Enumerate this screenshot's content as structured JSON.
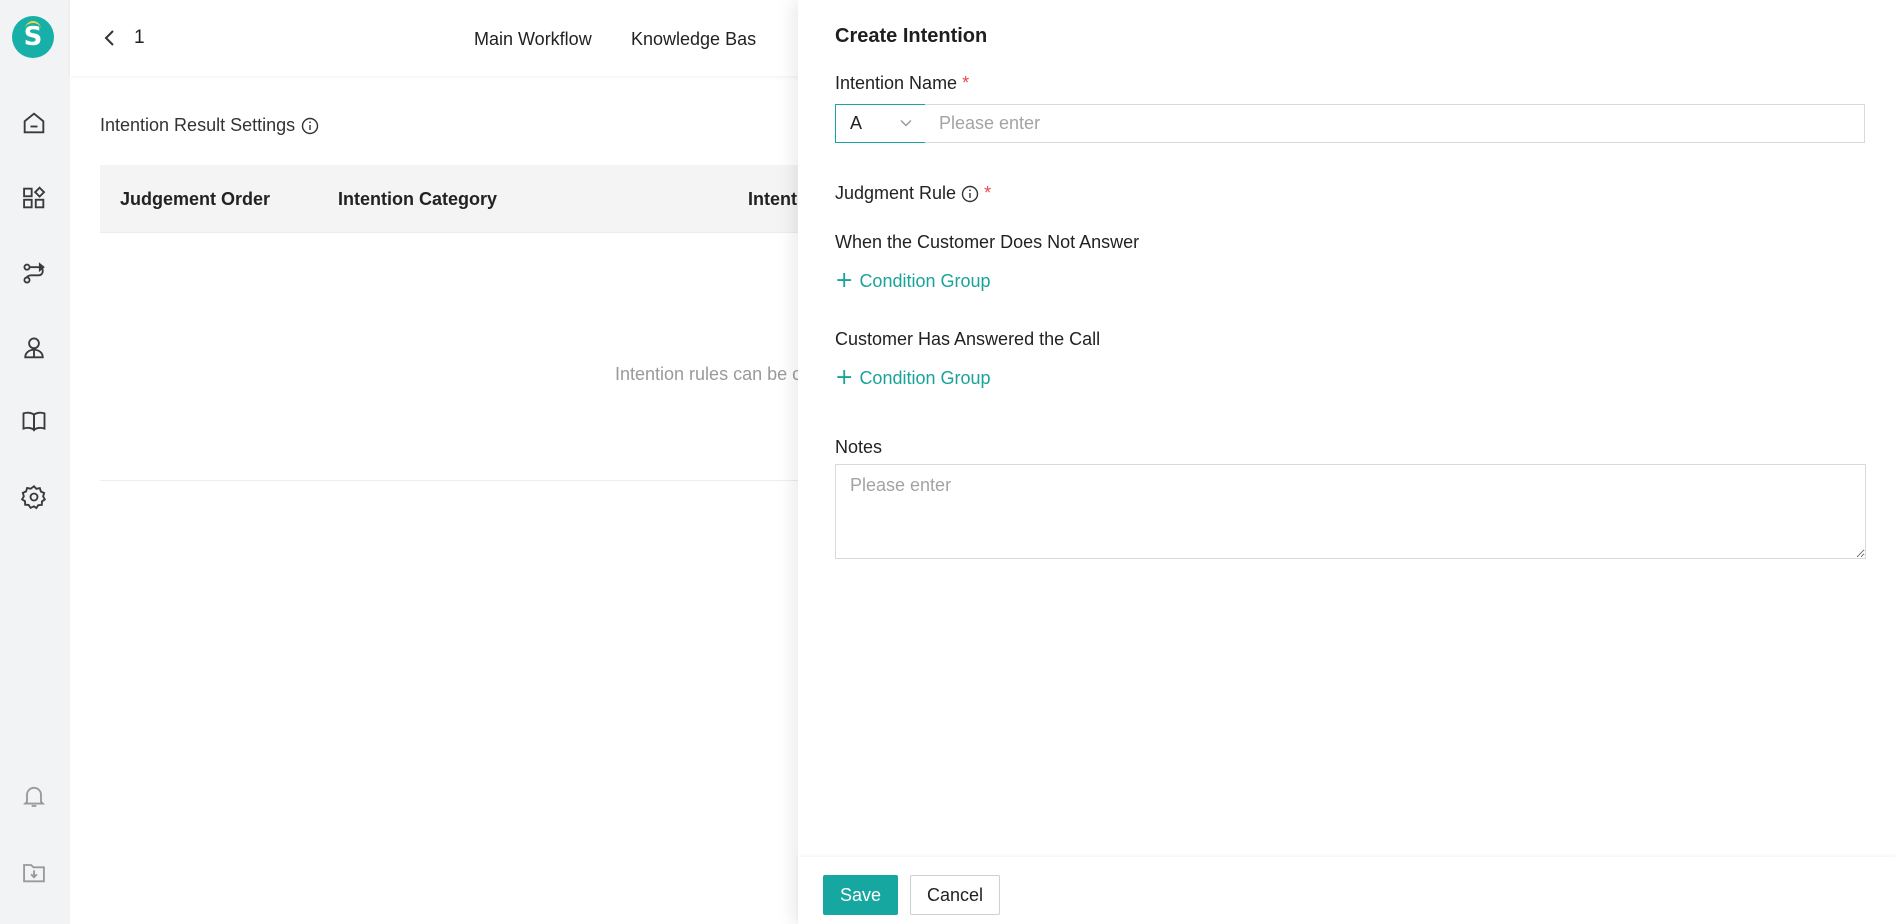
{
  "sidebar": {
    "logo": {
      "letter": "S",
      "color": "#16b0a8",
      "accent": "#f3d542"
    },
    "items": [
      {
        "icon": "home-icon"
      },
      {
        "icon": "apps-icon"
      },
      {
        "icon": "workflow-icon"
      },
      {
        "icon": "agent-icon"
      },
      {
        "icon": "book-icon"
      },
      {
        "icon": "gear-icon"
      }
    ],
    "bottom_items": [
      {
        "icon": "bell-icon"
      },
      {
        "icon": "download-folder-icon"
      }
    ]
  },
  "header": {
    "page_number": "1",
    "tabs": [
      {
        "label": "Main Workflow"
      },
      {
        "label": "Knowledge Bas"
      }
    ]
  },
  "main": {
    "section_title": "Intention Result Settings",
    "table": {
      "columns": [
        "Judgement Order",
        "Intention Category",
        "Intenti"
      ],
      "empty_text": "Intention rules can be c"
    }
  },
  "drawer": {
    "title": "Create Intention",
    "intention_name": {
      "label": "Intention Name",
      "required_mark": "*",
      "select_value": "A",
      "placeholder": "Please enter"
    },
    "judgment_rule": {
      "label": "Judgment Rule",
      "required_mark": "*",
      "no_answer_label": "When the Customer Does Not Answer",
      "answered_label": "Customer Has Answered the Call",
      "add_condition_label": "Condition Group"
    },
    "notes": {
      "label": "Notes",
      "placeholder": "Please enter"
    },
    "footer": {
      "save_label": "Save",
      "cancel_label": "Cancel"
    }
  },
  "colors": {
    "accent": "#16a8a0",
    "required": "#e8474b",
    "sidebar_bg": "#f2f3f5"
  }
}
